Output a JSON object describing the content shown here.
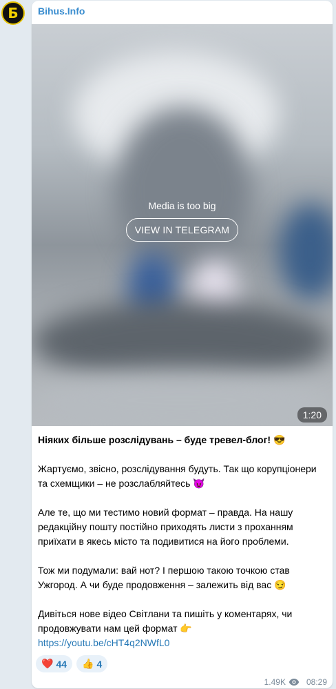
{
  "channel": {
    "name": "Bihus.Info",
    "avatar_letter": "Б"
  },
  "media": {
    "message": "Media is too big",
    "button_label": "VIEW IN TELEGRAM",
    "duration": "1:20"
  },
  "post": {
    "headline": "Ніяких більше розслідувань – буде тревел-блог! 😎",
    "p1": "Жартуємо, звісно, розслідування будуть. Так що корупціонери та схемщики – не розслабляйтесь 😈",
    "p2": "Але те, що ми тестимо новий формат – правда. На нашу редакційну пошту постійно приходять листи з проханням приїхати в якесь місто та подивитися на його проблеми.",
    "p3": "Тож ми подумали: вай нот? І першою такою точкою став Ужгород. А чи буде продовження – залежить від вас 😏",
    "p4": "Дивіться нове відео Світлани та пишіть у коментарях, чи продовжувати нам цей формат 👉",
    "link": "https://youtu.be/cHT4q2NWfL0"
  },
  "reactions": [
    {
      "emoji": "❤️",
      "count": "44"
    },
    {
      "emoji": "👍",
      "count": "4"
    }
  ],
  "meta": {
    "views": "1.49K",
    "time": "08:29",
    "views_icon": "eye-icon"
  }
}
